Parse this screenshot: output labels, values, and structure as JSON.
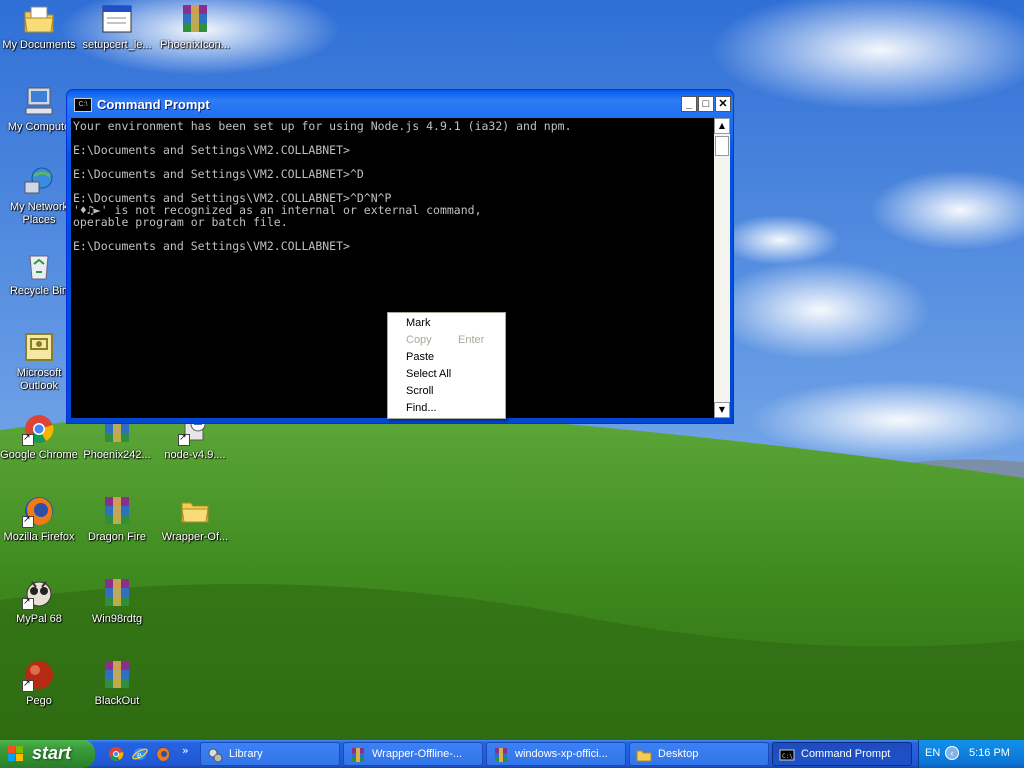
{
  "desktop_icons": [
    {
      "label": "My Documents",
      "icon": "my-documents-icon"
    },
    {
      "label": "setupcert_le...",
      "icon": "window-file-icon"
    },
    {
      "label": "PhoenixIcon...",
      "icon": "winrar-archive-icon"
    },
    {
      "label": "My Compute",
      "icon": "my-computer-icon"
    },
    {
      "label": "My Network Places",
      "icon": "network-places-icon"
    },
    {
      "label": "Recycle Bin",
      "icon": "recycle-bin-icon"
    },
    {
      "label": "Microsoft Outlook",
      "icon": "outlook-icon"
    },
    {
      "label": "Google Chrome",
      "icon": "chrome-icon"
    },
    {
      "label": "Phoenix242...",
      "icon": "winrar-archive-icon"
    },
    {
      "label": "node-v4.9....",
      "icon": "installer-icon"
    },
    {
      "label": "Mozilla Firefox",
      "icon": "firefox-icon"
    },
    {
      "label": "Dragon Fire",
      "icon": "winrar-archive-icon"
    },
    {
      "label": "Wrapper-Of...",
      "icon": "folder-icon"
    },
    {
      "label": "MyPal 68",
      "icon": "mypal-icon"
    },
    {
      "label": "Win98rdtg",
      "icon": "winrar-archive-icon"
    },
    {
      "label": "Pego",
      "icon": "pego-icon"
    },
    {
      "label": "BlackOut",
      "icon": "winrar-archive-icon"
    }
  ],
  "cmd_window": {
    "title": "Command Prompt",
    "icon_text": "C:\\",
    "minimize": "_",
    "maximize": "□",
    "close": "✕",
    "console_lines": [
      "Your environment has been set up for using Node.js 4.9.1 (ia32) and npm.",
      "",
      "E:\\Documents and Settings\\VM2.COLLABNET>",
      "",
      "E:\\Documents and Settings\\VM2.COLLABNET>^D",
      "",
      "E:\\Documents and Settings\\VM2.COLLABNET>^D^N^P",
      "'♦♫►' is not recognized as an internal or external command,",
      "operable program or batch file.",
      "",
      "E:\\Documents and Settings\\VM2.COLLABNET>"
    ]
  },
  "context_menu": {
    "items": [
      {
        "label": "Mark",
        "shortcut": "",
        "disabled": false
      },
      {
        "label": "Copy",
        "shortcut": "Enter",
        "disabled": true
      },
      {
        "label": "Paste",
        "shortcut": "",
        "disabled": false
      },
      {
        "label": "Select All",
        "shortcut": "",
        "disabled": false
      },
      {
        "label": "Scroll",
        "shortcut": "",
        "disabled": false
      },
      {
        "label": "Find...",
        "shortcut": "",
        "disabled": false
      }
    ]
  },
  "taskbar": {
    "start_label": "start",
    "quick_launch": [
      "chrome-icon",
      "internet-explorer-icon",
      "firefox-icon"
    ],
    "overflow": "»",
    "tasks": [
      {
        "label": "Library",
        "icon": "library-icon",
        "active": false
      },
      {
        "label": "Wrapper-Offline-...",
        "icon": "winrar-archive-icon",
        "active": false
      },
      {
        "label": "windows-xp-offici...",
        "icon": "winrar-archive-icon",
        "active": false
      },
      {
        "label": "Desktop",
        "icon": "folder-icon",
        "active": false
      },
      {
        "label": "Command Prompt",
        "icon": "command-prompt-icon",
        "active": true
      }
    ],
    "tray": {
      "language": "EN",
      "expand": "‹",
      "clock": "5:16 PM"
    }
  }
}
